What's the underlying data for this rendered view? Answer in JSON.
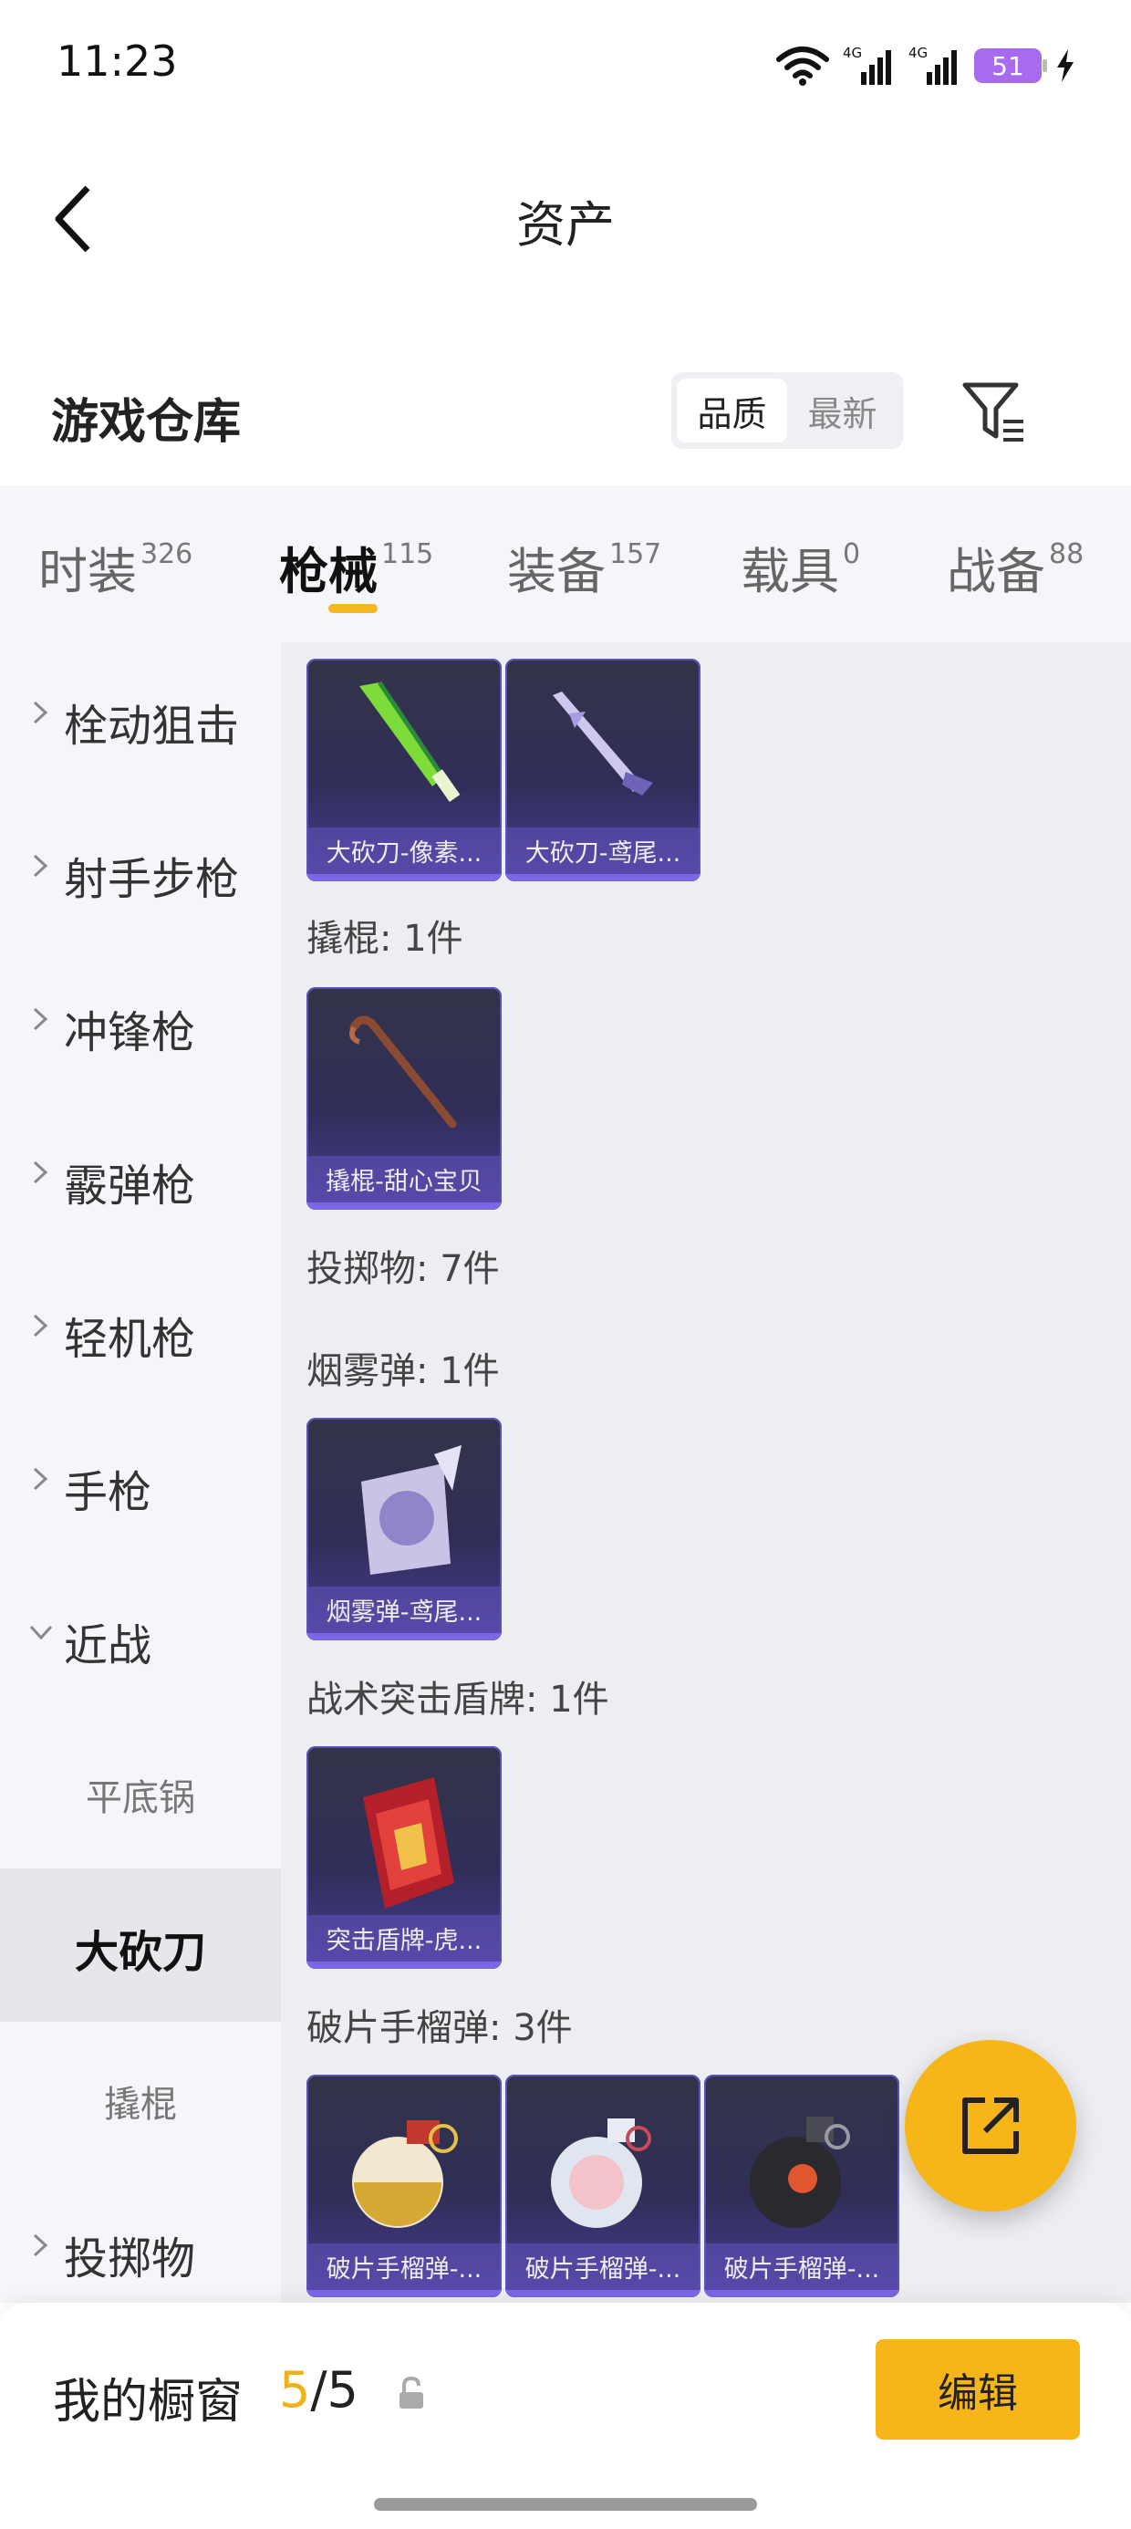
{
  "status": {
    "time": "11:23",
    "battery": "51"
  },
  "nav": {
    "title": "资产"
  },
  "header": {
    "title": "游戏仓库",
    "sort_quality": "品质",
    "sort_latest": "最新"
  },
  "tabs": [
    {
      "label": "时装",
      "count": "326"
    },
    {
      "label": "枪械",
      "count": "115"
    },
    {
      "label": "装备",
      "count": "157"
    },
    {
      "label": "载具",
      "count": "0"
    },
    {
      "label": "战备",
      "count": "88"
    }
  ],
  "sidebar": {
    "items": [
      {
        "label": "栓动狙击"
      },
      {
        "label": "射手步枪"
      },
      {
        "label": "冲锋枪"
      },
      {
        "label": "霰弹枪"
      },
      {
        "label": "轻机枪"
      },
      {
        "label": "手枪"
      },
      {
        "label": "近战"
      },
      {
        "label": "投掷物"
      }
    ],
    "subitems": [
      {
        "label": "平底锅"
      },
      {
        "label": "大砍刀"
      },
      {
        "label": "撬棍"
      }
    ]
  },
  "content": {
    "top_cards": [
      {
        "name": "大砍刀-像素..."
      },
      {
        "name": "大砍刀-鸢尾..."
      }
    ],
    "sections": [
      {
        "label": "撬棍: 1件",
        "cards": [
          {
            "name": "撬棍-甜心宝贝"
          }
        ]
      },
      {
        "label": "投掷物: 7件"
      },
      {
        "label": "烟雾弹: 1件",
        "cards": [
          {
            "name": "烟雾弹-鸢尾..."
          }
        ]
      },
      {
        "label": "战术突击盾牌: 1件",
        "cards": [
          {
            "name": "突击盾牌-虎..."
          }
        ]
      },
      {
        "label": "破片手榴弹: 3件",
        "cards": [
          {
            "name": "破片手榴弹-..."
          },
          {
            "name": "破片手榴弹-..."
          },
          {
            "name": "破片手榴弹-..."
          }
        ]
      }
    ]
  },
  "showcase": {
    "label": "我的橱窗",
    "current": "5",
    "total": "/5"
  },
  "edit_label": "编辑",
  "colors": {
    "accent": "#f6b619",
    "card_bg": "#302e57",
    "card_border": "#5b50b8"
  },
  "icons": {
    "back": "chevron-left-icon",
    "filter": "filter-icon",
    "share": "external-link-icon",
    "lock": "lock-icon"
  }
}
